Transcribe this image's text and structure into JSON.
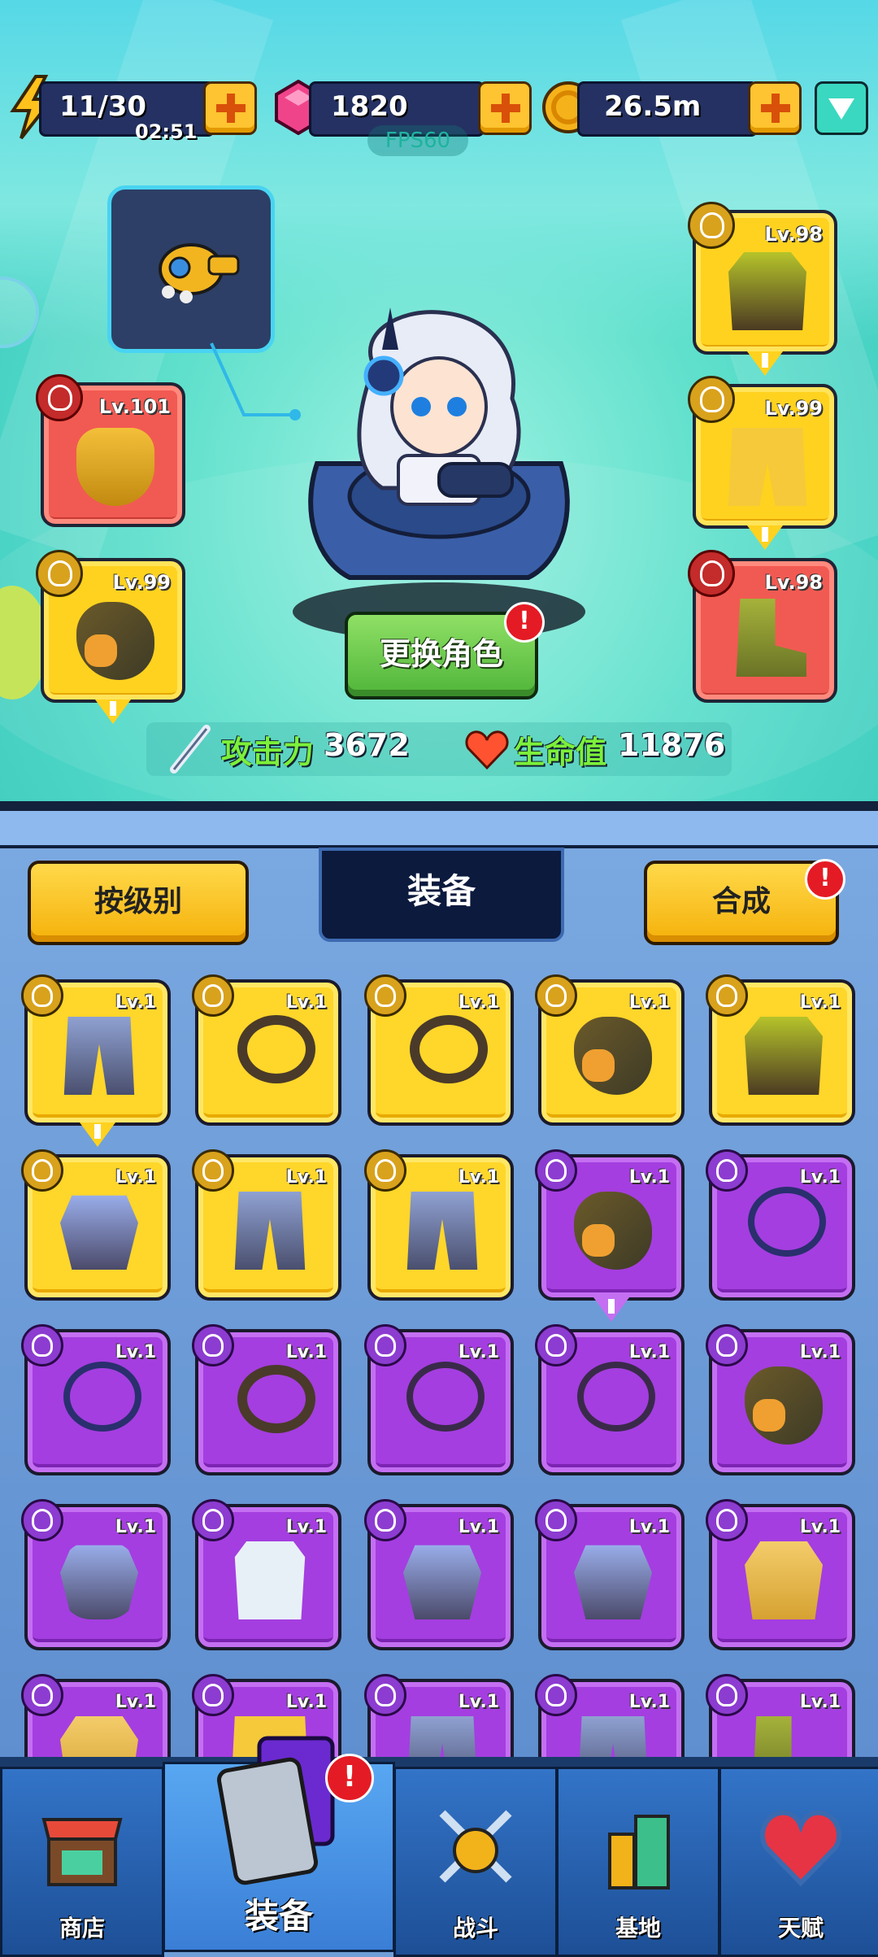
{
  "resources": {
    "energy": {
      "value": "11/30",
      "timer": "02:51",
      "icon": "lightning-icon"
    },
    "gems": {
      "value": "1820",
      "icon": "gem-icon"
    },
    "coins": {
      "value": "26.5m",
      "icon": "coin-icon"
    },
    "fps": "FPS60"
  },
  "character": {
    "change_button": "更换角色",
    "attack_label": "攻击力",
    "attack_value": "3672",
    "hp_label": "生命值",
    "hp_value": "11876"
  },
  "equipped": {
    "left": [
      {
        "slot": "necklace",
        "level": "Lv.101",
        "rarity": "red"
      },
      {
        "slot": "glove",
        "level": "Lv.99",
        "rarity": "yellow"
      }
    ],
    "right": [
      {
        "slot": "vest",
        "level": "Lv.98",
        "rarity": "yellow"
      },
      {
        "slot": "shorts",
        "level": "Lv.99",
        "rarity": "yellow"
      },
      {
        "slot": "boots",
        "level": "Lv.98",
        "rarity": "red"
      }
    ]
  },
  "toolbar": {
    "sort_label": "按级别",
    "title": "装备",
    "merge_label": "合成",
    "alert": "!"
  },
  "inventory": [
    [
      "Lv.1",
      "Lv.1",
      "Lv.1",
      "Lv.1",
      "Lv.1"
    ],
    [
      "Lv.1",
      "Lv.1",
      "Lv.1",
      "Lv.1",
      "Lv.1"
    ],
    [
      "Lv.1",
      "Lv.1",
      "Lv.1",
      "Lv.1",
      "Lv.1"
    ],
    [
      "Lv.1",
      "Lv.1",
      "Lv.1",
      "Lv.1",
      "Lv.1"
    ],
    [
      "Lv.1",
      "Lv.1",
      "Lv.1",
      "Lv.1",
      "Lv.1"
    ]
  ],
  "nav": {
    "shop": "商店",
    "equip": "装备",
    "battle": "战斗",
    "base": "基地",
    "talent": "天赋"
  }
}
